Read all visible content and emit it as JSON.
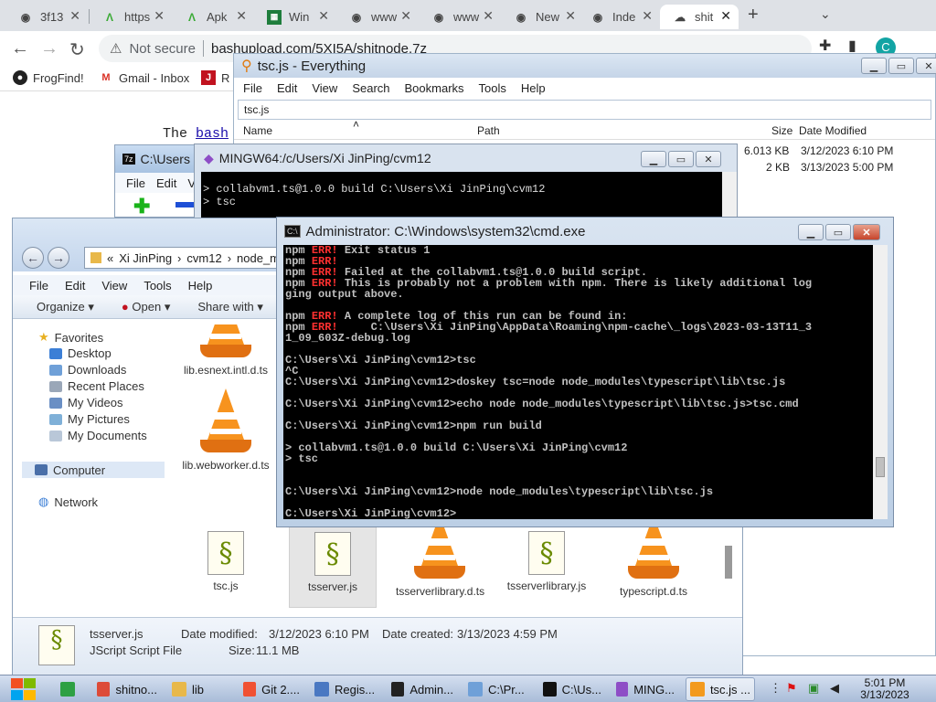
{
  "browser": {
    "tabs": [
      {
        "label": "3f13",
        "icon": "globe"
      },
      {
        "label": "https",
        "icon": "apk"
      },
      {
        "label": "Apk",
        "icon": "apk"
      },
      {
        "label": "Win",
        "icon": "sheet"
      },
      {
        "label": "www",
        "icon": "globe"
      },
      {
        "label": "www",
        "icon": "globe"
      },
      {
        "label": "New",
        "icon": "chrome"
      },
      {
        "label": "Inde",
        "icon": "globe"
      },
      {
        "label": "shit",
        "icon": "upload"
      }
    ],
    "new_tab": "+",
    "address": {
      "security": "Not secure",
      "url": "bashupload.com/5XI5A/shitnode.7z"
    },
    "bookmarks": [
      {
        "label": "FrogFind!",
        "icon": "frog"
      },
      {
        "label": "Gmail - Inbox",
        "icon": "gmail"
      },
      {
        "label": "R",
        "icon": "doc"
      }
    ],
    "avatar_letter": "C",
    "page_text_prefix": "The ",
    "page_link": "bash"
  },
  "everything": {
    "title": "tsc.js - Everything",
    "menu": [
      "File",
      "Edit",
      "View",
      "Search",
      "Bookmarks",
      "Tools",
      "Help"
    ],
    "search": "tsc.js",
    "columns": [
      "Name",
      "Path",
      "Size",
      "Date Modified"
    ],
    "rows": [
      {
        "size": "6.013 KB",
        "date": "3/12/2023 6:10 PM"
      },
      {
        "size": "2 KB",
        "date": "3/13/2023 5:00 PM"
      }
    ]
  },
  "sevenzip": {
    "title": "C:\\Users",
    "menu": [
      "File",
      "Edit",
      "V"
    ]
  },
  "mingw": {
    "title": "MINGW64:/c/Users/Xi JinPing/cvm12",
    "lines": [
      "> collabvm1.ts@1.0.0 build C:\\Users\\Xi JinPing\\cvm12",
      "> tsc"
    ]
  },
  "explorer": {
    "breadcrumb": [
      "«",
      "Xi JinPing",
      "cvm12",
      "node_m"
    ],
    "menu": [
      "File",
      "Edit",
      "View",
      "Tools",
      "Help"
    ],
    "commands": [
      "Organize",
      "Open",
      "Share with"
    ],
    "nav": {
      "favorites": "Favorites",
      "favorite_items": [
        "Desktop",
        "Downloads",
        "Recent Places",
        "My Videos",
        "My Pictures",
        "My Documents"
      ],
      "computer": "Computer",
      "network": "Network"
    },
    "files": [
      {
        "name": "lib.esnext.intl.d.ts",
        "type": "cone"
      },
      {
        "name": "lib.webworker.d.ts",
        "type": "cone"
      },
      {
        "name": "tsc.js",
        "type": "script"
      },
      {
        "name": "tsserver.js",
        "type": "script",
        "selected": true
      },
      {
        "name": "tsserverlibrary.d.ts",
        "type": "cone"
      },
      {
        "name": "tsserverlibrary.js",
        "type": "script"
      },
      {
        "name": "typescript.d.ts",
        "type": "cone"
      }
    ],
    "details": {
      "name": "tsserver.js",
      "type": "JScript Script File",
      "modified_label": "Date modified:",
      "modified": "3/12/2023 6:10 PM",
      "created_label": "Date created:",
      "created": "3/13/2023 4:59 PM",
      "size_label": "Size:",
      "size": "11.1 MB"
    }
  },
  "cmd": {
    "title": "Administrator: C:\\Windows\\system32\\cmd.exe",
    "lines": [
      {
        "t": "npm ",
        "e": "ERR!",
        "r": " Exit status 1"
      },
      {
        "t": "npm ",
        "e": "ERR!",
        "r": ""
      },
      {
        "t": "npm ",
        "e": "ERR!",
        "r": " Failed at the collabvm1.ts@1.0.0 build script."
      },
      {
        "t": "npm ",
        "e": "ERR!",
        "r": " This is probably not a problem with npm. There is likely additional log"
      },
      {
        "t": "ging output above.",
        "e": "",
        "r": ""
      },
      {
        "t": "",
        "e": "",
        "r": ""
      },
      {
        "t": "npm ",
        "e": "ERR!",
        "r": " A complete log of this run can be found in:"
      },
      {
        "t": "npm ",
        "e": "ERR!",
        "r": "     C:\\Users\\Xi JinPing\\AppData\\Roaming\\npm-cache\\_logs\\2023-03-13T11_3"
      },
      {
        "t": "1_09_603Z-debug.log",
        "e": "",
        "r": ""
      },
      {
        "t": "",
        "e": "",
        "r": ""
      },
      {
        "t": "C:\\Users\\Xi JinPing\\cvm12>tsc",
        "e": "",
        "r": ""
      },
      {
        "t": "^C",
        "e": "",
        "r": ""
      },
      {
        "t": "C:\\Users\\Xi JinPing\\cvm12>doskey tsc=node node_modules\\typescript\\lib\\tsc.js",
        "e": "",
        "r": ""
      },
      {
        "t": "",
        "e": "",
        "r": ""
      },
      {
        "t": "C:\\Users\\Xi JinPing\\cvm12>echo node node_modules\\typescript\\lib\\tsc.js>tsc.cmd",
        "e": "",
        "r": ""
      },
      {
        "t": "",
        "e": "",
        "r": ""
      },
      {
        "t": "C:\\Users\\Xi JinPing\\cvm12>npm run build",
        "e": "",
        "r": ""
      },
      {
        "t": "",
        "e": "",
        "r": ""
      },
      {
        "t": "> collabvm1.ts@1.0.0 build C:\\Users\\Xi JinPing\\cvm12",
        "e": "",
        "r": ""
      },
      {
        "t": "> tsc",
        "e": "",
        "r": ""
      },
      {
        "t": "",
        "e": "",
        "r": ""
      },
      {
        "t": "",
        "e": "",
        "r": ""
      },
      {
        "t": "C:\\Users\\Xi JinPing\\cvm12>node node_modules\\typescript\\lib\\tsc.js",
        "e": "",
        "r": ""
      },
      {
        "t": "",
        "e": "",
        "r": ""
      },
      {
        "t": "C:\\Users\\Xi JinPing\\cvm12>",
        "e": "",
        "r": ""
      }
    ]
  },
  "taskbar": {
    "items": [
      {
        "label": "",
        "icon": "notepad-green",
        "color": "#2ea043"
      },
      {
        "label": "shitno...",
        "icon": "chrome",
        "color": "#dd4b39"
      },
      {
        "label": "lib",
        "icon": "folder",
        "color": "#e8b84a"
      },
      {
        "label": "Git 2....",
        "icon": "git",
        "color": "#f05133"
      },
      {
        "label": "Regis...",
        "icon": "regedit",
        "color": "#4a78c2"
      },
      {
        "label": "Admin...",
        "icon": "cmd",
        "color": "#222222"
      },
      {
        "label": "C:\\Pr...",
        "icon": "notepad",
        "color": "#6fa0d8"
      },
      {
        "label": "C:\\Us...",
        "icon": "7zip",
        "color": "#111111"
      },
      {
        "label": "MING...",
        "icon": "mingw",
        "color": "#8e4ec6"
      },
      {
        "label": "tsc.js ...",
        "icon": "everything",
        "color": "#f39a1e"
      }
    ],
    "time": "5:01 PM",
    "date": "3/13/2023"
  }
}
